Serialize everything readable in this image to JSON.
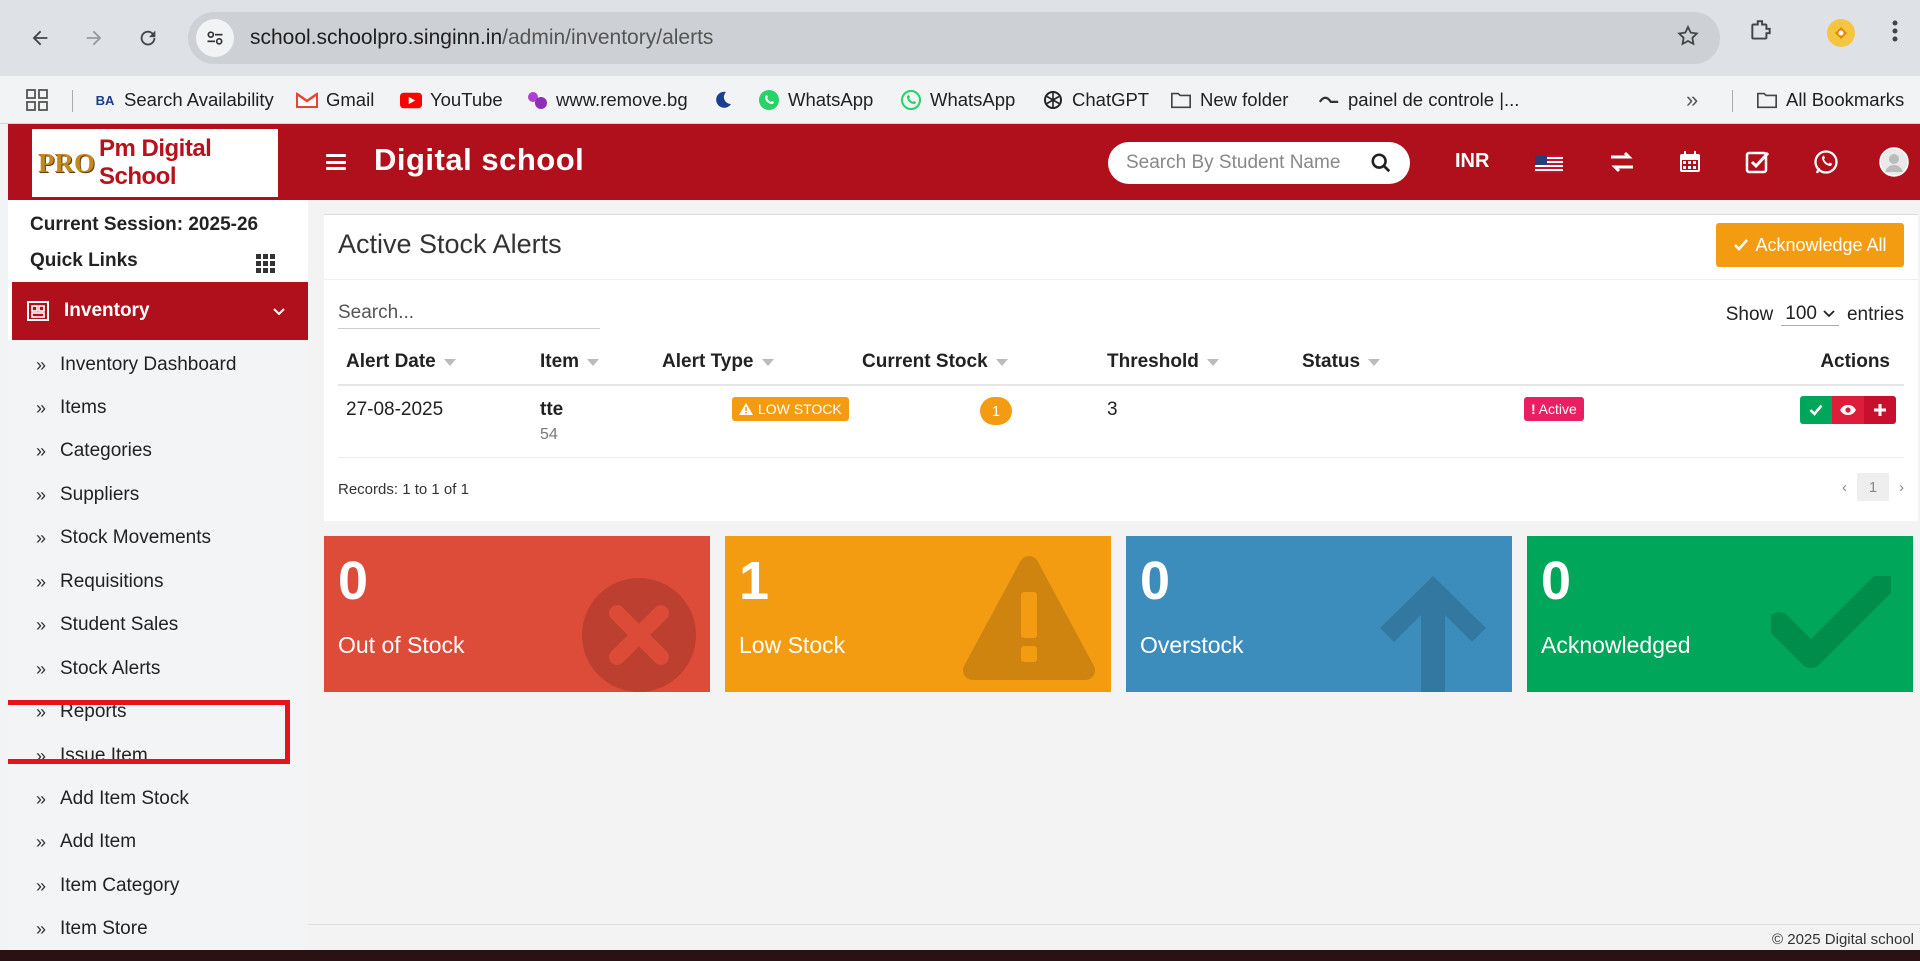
{
  "browser": {
    "url_domain": "school.schoolpro.singinn.in",
    "url_path": "/admin/inventory/alerts",
    "bookmarks": [
      {
        "label": "Search Availability",
        "icon": "ba-icon"
      },
      {
        "label": "Gmail",
        "icon": "gmail-icon"
      },
      {
        "label": "YouTube",
        "icon": "youtube-icon"
      },
      {
        "label": "www.remove.bg",
        "icon": "removebg-icon"
      },
      {
        "label": "",
        "icon": "moon-icon"
      },
      {
        "label": "WhatsApp",
        "icon": "whatsapp-icon"
      },
      {
        "label": "WhatsApp",
        "icon": "whatsapp-icon"
      },
      {
        "label": "ChatGPT",
        "icon": "chatgpt-icon"
      },
      {
        "label": "New folder",
        "icon": "folder-icon"
      },
      {
        "label": "painel de controle |...",
        "icon": "panel-icon"
      }
    ],
    "all_bookmarks": "All Bookmarks"
  },
  "header": {
    "logo_pro": "PRO",
    "logo_text": "Pm Digital School",
    "title": "Digital school",
    "search_placeholder": "Search By Student Name",
    "currency": "INR"
  },
  "sidebar": {
    "session": "Current Session: 2025-26",
    "quick_links": "Quick Links",
    "section": "Inventory",
    "items": [
      "Inventory Dashboard",
      "Items",
      "Categories",
      "Suppliers",
      "Stock Movements",
      "Requisitions",
      "Student Sales",
      "Stock Alerts",
      "Reports",
      "Issue Item",
      "Add Item Stock",
      "Add Item",
      "Item Category",
      "Item Store"
    ],
    "highlighted_item": "Stock Alerts"
  },
  "alerts_card": {
    "title": "Active Stock Alerts",
    "acknowledge_all": "Acknowledge All",
    "search_placeholder": "Search...",
    "show_label": "Show",
    "entries_value": "100",
    "entries_label": "entries",
    "columns": [
      "Alert Date",
      "Item",
      "Alert Type",
      "Current Stock",
      "Threshold",
      "Status",
      "Actions"
    ],
    "rows": [
      {
        "alert_date": "27-08-2025",
        "item_name": "tte",
        "item_sub": "54",
        "alert_type": "LOW STOCK",
        "current_stock": "1",
        "threshold": "3",
        "status": "Active"
      }
    ],
    "records": "Records: 1 to 1 of 1",
    "page": "1"
  },
  "stats": [
    {
      "value": "0",
      "label": "Out of Stock",
      "color": "#dd4b39",
      "icon": "times-circle-icon"
    },
    {
      "value": "1",
      "label": "Low Stock",
      "color": "#f39c12",
      "icon": "warning-icon"
    },
    {
      "value": "0",
      "label": "Overstock",
      "color": "#3c8dbc",
      "icon": "arrow-up-icon"
    },
    {
      "value": "0",
      "label": "Acknowledged",
      "color": "#00a65a",
      "icon": "check-icon"
    }
  ],
  "footer": {
    "copyright": "© 2025 Digital school"
  },
  "colors": {
    "brand_red": "#b0101c",
    "warning": "#f39c12",
    "active_badge": "#e91e63"
  }
}
